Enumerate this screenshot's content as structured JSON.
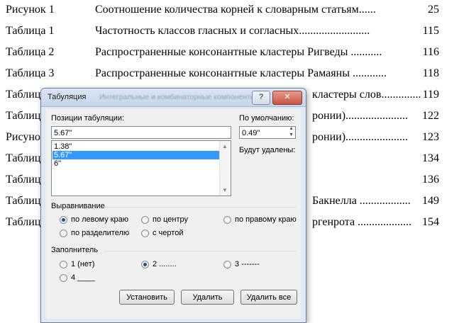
{
  "document": {
    "rows": [
      {
        "label": "Рисунок 1",
        "title": "Соотношение количества корней к словарным статьям......",
        "page": "25"
      },
      {
        "label": "Таблица 1",
        "title": "Частотность классов гласных и согласных.........................",
        "page": "115"
      },
      {
        "label": "Таблица 2",
        "title": "Распространенные консонантные кластеры Ригведы ...........",
        "page": "116"
      },
      {
        "label": "Таблица 3",
        "title": "Распространенные консонантные кластеры Рамаяны ............",
        "page": "118"
      },
      {
        "label": "Таблиц",
        "title": "кластеры слов..............",
        "page": "119"
      },
      {
        "label": "Таблиц",
        "title": "ронии)......................",
        "page": "122"
      },
      {
        "label": "Рисуно",
        "title": "ронии)......................",
        "page": "123"
      },
      {
        "label": "Таблиц",
        "title": "",
        "page": "134"
      },
      {
        "label": "Таблиц",
        "title": "",
        "page": "136"
      },
      {
        "label": "Таблиц",
        "title": "Бакнелла ..................",
        "page": "149"
      },
      {
        "label": "Таблиц",
        "title": "ргенрота ...................",
        "page": "154"
      }
    ]
  },
  "dialog": {
    "title": "Табуляция",
    "ghost_title": "Интегральные и комбинаторные компоненты",
    "help_label": "?",
    "close_label": "✕",
    "positions_label": "Позиции табуляции:",
    "positions_value": "5.67\"",
    "default_label": "По умолчанию:",
    "default_value": "0.49\"",
    "to_clear_label": "Будут удалены:",
    "tab_list": [
      "1.38\"",
      "5.67\"",
      "6\""
    ],
    "alignment": {
      "heading": "Выравнивание",
      "left": "по левому краю",
      "center": "по центру",
      "right": "по правому краю",
      "decimal": "по разделителю",
      "bar": "с чертой",
      "selected": "left"
    },
    "leader": {
      "heading": "Заполнитель",
      "opt1": "1 (нет)",
      "opt2": "2 ........",
      "opt3": "3 -------",
      "opt4": "4 ____",
      "selected": "2"
    },
    "buttons": {
      "set": "Установить",
      "clear": "Удалить",
      "clear_all": "Удалить все"
    }
  }
}
